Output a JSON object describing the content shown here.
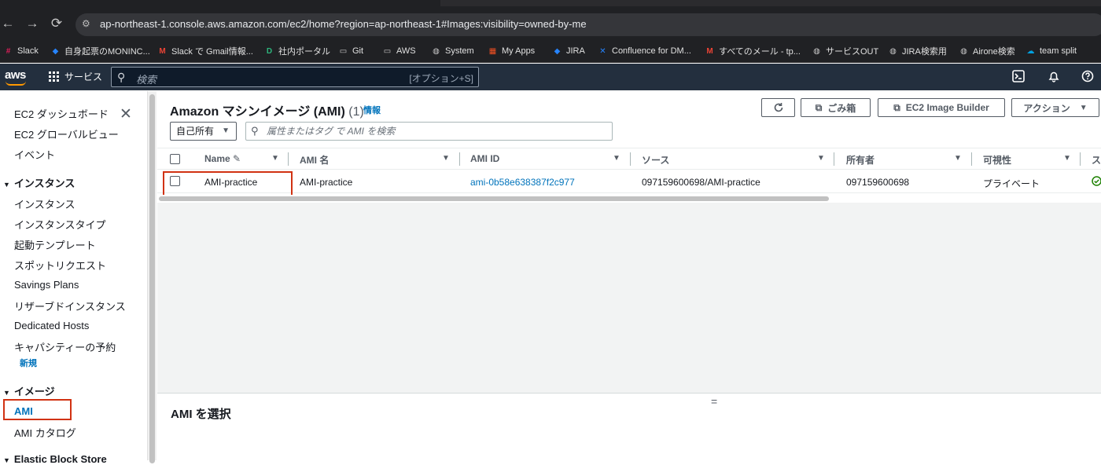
{
  "browser": {
    "url": "ap-northeast-1.console.aws.amazon.com/ec2/home?region=ap-northeast-1#Images:visibility=owned-by-me",
    "bookmarks": [
      {
        "label": "Slack",
        "icon": "slack-icon",
        "color": "#e01e5a"
      },
      {
        "label": "自身起票のMONINC...",
        "icon": "jira-icon",
        "color": "#2684ff"
      },
      {
        "label": "Slack で Gmail情報...",
        "icon": "gmail-icon",
        "color": "#ea4335"
      },
      {
        "label": "社内ポータル",
        "icon": "portal-icon",
        "color": "#2eb67d"
      },
      {
        "label": "Git",
        "icon": "folder-icon",
        "color": ""
      },
      {
        "label": "AWS",
        "icon": "folder-icon",
        "color": ""
      },
      {
        "label": "System",
        "icon": "globe-icon",
        "color": ""
      },
      {
        "label": "My Apps",
        "icon": "microsoft-icon",
        "color": "#f25022"
      },
      {
        "label": "JIRA",
        "icon": "jira-icon",
        "color": "#2684ff"
      },
      {
        "label": "Confluence for DM...",
        "icon": "confluence-icon",
        "color": "#2684ff"
      },
      {
        "label": "すべてのメール - tp...",
        "icon": "gmail-icon",
        "color": "#ea4335"
      },
      {
        "label": "サービスOUT",
        "icon": "globe-icon",
        "color": ""
      },
      {
        "label": "JIRA検索用",
        "icon": "globe-icon",
        "color": ""
      },
      {
        "label": "Airone検索",
        "icon": "globe-icon",
        "color": ""
      },
      {
        "label": "team split",
        "icon": "salesforce-icon",
        "color": "#00a1e0"
      }
    ]
  },
  "aws_header": {
    "logo": "aws",
    "services_label": "サービス",
    "search_placeholder": "検索",
    "search_shortcut": "[オプション+S]"
  },
  "sidebar": {
    "top_items": [
      "EC2 ダッシュボード",
      "EC2 グローバルビュー",
      "イベント"
    ],
    "sections": [
      {
        "title": "インスタンス",
        "items": [
          "インスタンス",
          "インスタンスタイプ",
          "起動テンプレート",
          "スポットリクエスト",
          "Savings Plans",
          "リザーブドインスタンス",
          "Dedicated Hosts",
          "キャパシティーの予約"
        ],
        "new_badge": "新規"
      },
      {
        "title": "イメージ",
        "items": [
          "AMI",
          "AMI カタログ"
        ]
      },
      {
        "title": "Elastic Block Store",
        "items": []
      }
    ]
  },
  "main": {
    "title": "Amazon マシンイメージ (AMI)",
    "count": "(1)",
    "info": "情報",
    "buttons": {
      "refresh": "refresh-icon",
      "recycle_bin": "ごみ箱",
      "image_builder": "EC2 Image Builder",
      "actions": "アクション"
    },
    "filter_value": "自己所有",
    "search_placeholder": "属性またはタグ で AMI を検索",
    "columns": [
      "Name",
      "AMI 名",
      "AMI ID",
      "ソース",
      "所有者",
      "可視性",
      "ス"
    ],
    "rows": [
      {
        "name": "AMI-practice",
        "ami_name": "AMI-practice",
        "ami_id": "ami-0b58e638387f2c977",
        "source": "097159600698/AMI-practice",
        "owner": "097159600698",
        "visibility": "プライベート"
      }
    ],
    "detail_title": "AMI を選択"
  }
}
